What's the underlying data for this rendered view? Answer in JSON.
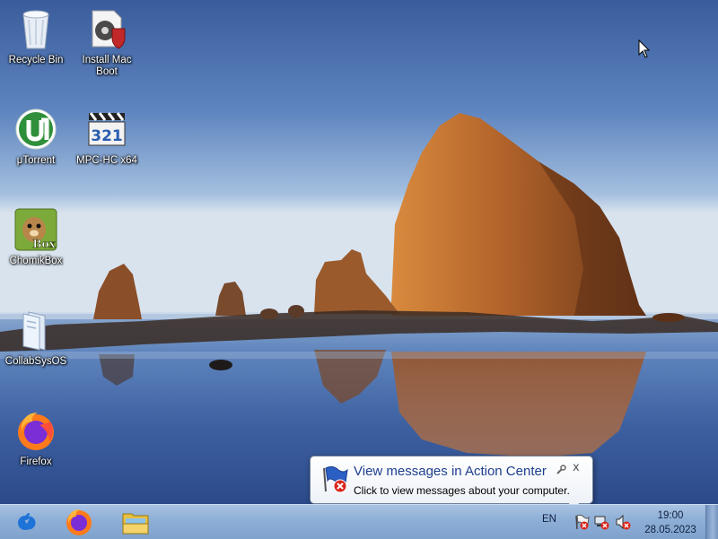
{
  "desktop": {
    "icons": [
      {
        "label": "Recycle Bin",
        "icon": "recycle-bin-icon"
      },
      {
        "label": "Install Mac Boot",
        "label2": "Boot",
        "label1": "Install Mac",
        "icon": "installer-shield-icon"
      },
      {
        "label": "μTorrent",
        "icon": "utorrent-icon"
      },
      {
        "label": "MPC-HC x64",
        "icon": "mpc-hc-icon",
        "badge": "321"
      },
      {
        "label": "ChomikBox",
        "icon": "chomikbox-icon",
        "badge": "Box"
      },
      {
        "label": "CollabSysOS",
        "icon": "collabsysos-folder-icon"
      },
      {
        "label": "Firefox",
        "icon": "firefox-icon"
      }
    ]
  },
  "notification": {
    "title": "View messages in Action Center",
    "message": "Click to view messages about your computer.",
    "close_glyph": "x",
    "icon": "action-center-flag-icon"
  },
  "taskbar": {
    "start_icon": "apple-start-icon",
    "pinned": [
      "firefox-icon",
      "file-explorer-icon"
    ],
    "language": "EN",
    "tray": [
      "action-center-flag-icon",
      "network-error-icon",
      "volume-muted-icon"
    ],
    "time": "19:00",
    "date": "28.05.2023"
  },
  "colors": {
    "taskbar": "#8fb0d7",
    "balloon_title": "#1e3f8e",
    "sky_top": "#3a5c9c",
    "rock": "#b0622a"
  }
}
